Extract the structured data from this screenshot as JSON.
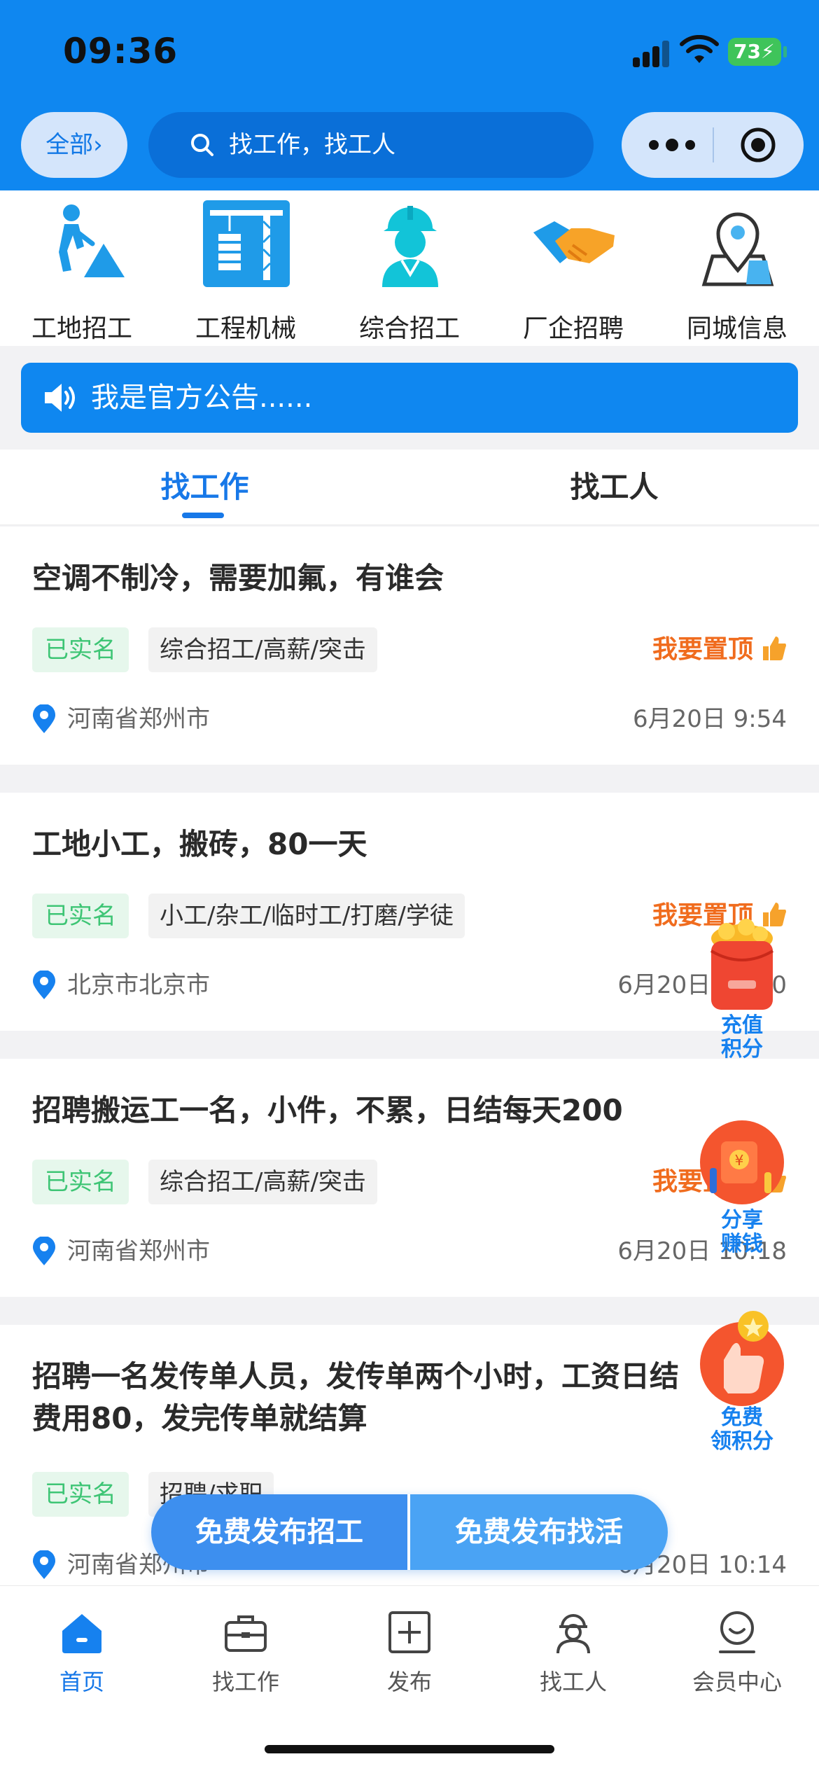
{
  "status_bar": {
    "time": "09:36",
    "battery": "73"
  },
  "header": {
    "all_label": "全部›",
    "search_placeholder": "找工作，找工人"
  },
  "categories": [
    {
      "label": "工地招工",
      "icon": "construction-worker-icon"
    },
    {
      "label": "工程机械",
      "icon": "tower-crane-icon"
    },
    {
      "label": "综合招工",
      "icon": "hardhat-worker-icon"
    },
    {
      "label": "厂企招聘",
      "icon": "handshake-icon"
    },
    {
      "label": "同城信息",
      "icon": "map-pin-icon"
    }
  ],
  "notice": {
    "text": "我是官方公告......"
  },
  "tabs": [
    {
      "label": "找工作",
      "active": true
    },
    {
      "label": "找工人",
      "active": false
    }
  ],
  "listings": [
    {
      "title": "空调不制冷，需要加氟，有谁会",
      "verified": "已实名",
      "tag": "综合招工/高薪/突击",
      "pin_label": "我要置顶",
      "location": "河南省郑州市",
      "date": "6月20日 9:54"
    },
    {
      "title": "工地小工，搬砖，80一天",
      "verified": "已实名",
      "tag": "小工/杂工/临时工/打磨/学徒",
      "pin_label": "我要置顶",
      "location": "北京市北京市",
      "date": "6月20日 10:20"
    },
    {
      "title": "招聘搬运工一名，小件，不累，日结每天200",
      "verified": "已实名",
      "tag": "综合招工/高薪/突击",
      "pin_label": "我要置顶",
      "location": "河南省郑州市",
      "date": "6月20日 10:18"
    },
    {
      "title_line1": "招聘一名发传单人员，发传单两个小时，工资日结",
      "title_line2": "费用80，发完传单就结算",
      "verified": "已实名",
      "tag": "招聘/求职",
      "location": "河南省郑州市",
      "date": "6月20日 10:14"
    }
  ],
  "floating": [
    {
      "label_line1": "充值",
      "label_line2": "积分",
      "icon": "red-envelope-icon"
    },
    {
      "label_line1": "分享",
      "label_line2": "赚钱",
      "icon": "share-gift-icon"
    },
    {
      "label_line1": "免费",
      "label_line2": "领积分",
      "icon": "thumb-coin-icon"
    }
  ],
  "publish": {
    "left_label": "免费发布招工",
    "right_label": "免费发布找活"
  },
  "tabbar": [
    {
      "label": "首页",
      "icon": "home-icon",
      "active": true
    },
    {
      "label": "找工作",
      "icon": "briefcase-icon",
      "active": false
    },
    {
      "label": "发布",
      "icon": "plus-square-icon",
      "active": false
    },
    {
      "label": "找工人",
      "icon": "worker-icon",
      "active": false
    },
    {
      "label": "会员中心",
      "icon": "member-icon",
      "active": false
    }
  ],
  "colors": {
    "primary": "#0f87f0",
    "accent_orange": "#f06c1e",
    "verified_green": "#3ec575"
  }
}
